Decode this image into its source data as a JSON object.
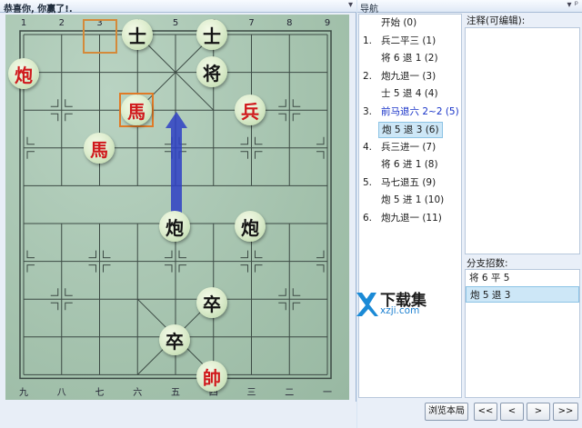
{
  "board_panel": {
    "title": "恭喜你, 你赢了!.",
    "pin": "▾"
  },
  "top_coords": [
    "1",
    "2",
    "3",
    "4",
    "5",
    "6",
    "7",
    "8",
    "9"
  ],
  "bottom_coords": [
    "九",
    "八",
    "七",
    "六",
    "五",
    "四",
    "三",
    "二",
    "一"
  ],
  "pieces": {
    "black_shi_1": "士",
    "black_shi_2": "士",
    "black_jiang": "将",
    "black_pao": "炮",
    "red_ma_1": "馬",
    "red_ma_2": "馬",
    "red_bing": "兵",
    "black_pao_2": "炮",
    "black_pao_3": "炮",
    "black_zu_1": "卒",
    "black_zu_2": "卒",
    "red_shuai": "帥"
  },
  "colors": {
    "red": "#d0191c",
    "black": "#141414",
    "arrow": "#2e3fc4",
    "highlight": "#e07a26"
  },
  "nav": {
    "title": "导航",
    "pin": "▾ ᵖ",
    "moves": [
      {
        "num": "",
        "text": "开始 (0)"
      },
      {
        "num": "1.",
        "text": "兵二平三 (1)"
      },
      {
        "num": "",
        "text": "将 6 退 1 (2)"
      },
      {
        "num": "2.",
        "text": "炮九退一 (3)"
      },
      {
        "num": "",
        "text": "士 5 退 4 (4)"
      },
      {
        "num": "3.",
        "text": "前马退六 2~2 (5)"
      },
      {
        "num": "",
        "text": "炮 5 退 3 (6)"
      },
      {
        "num": "4.",
        "text": "兵三进一 (7)"
      },
      {
        "num": "",
        "text": "将 6 进 1 (8)"
      },
      {
        "num": "5.",
        "text": "马七退五 (9)"
      },
      {
        "num": "",
        "text": "炮 5 进 1 (10)"
      },
      {
        "num": "6.",
        "text": "炮九退一 (11)"
      }
    ]
  },
  "notes": {
    "label": "注释(可编辑):"
  },
  "branch": {
    "label": "分支招数:",
    "items": [
      "将 6 平 5",
      "炮 5 退 3"
    ]
  },
  "buttons": {
    "browse": "浏览本局",
    "first": "<<",
    "prev": "<",
    "next": ">",
    "last": ">>"
  },
  "watermark": {
    "name": "下载集",
    "url": "xzji.com"
  }
}
